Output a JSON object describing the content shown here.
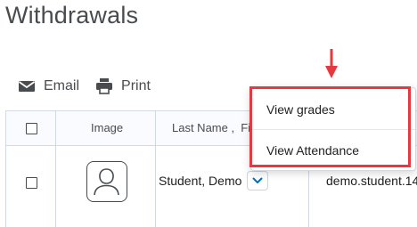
{
  "page": {
    "title": "Withdrawals"
  },
  "toolbar": {
    "email_label": "Email",
    "print_label": "Print"
  },
  "table": {
    "headers": {
      "image": "Image",
      "name": "Last Name ,  Fir"
    },
    "rows": [
      {
        "name": "Student, Demo",
        "username": "demo.student.14"
      }
    ]
  },
  "context_menu": {
    "items": [
      {
        "label": "View grades"
      },
      {
        "label": "View Attendance"
      }
    ]
  },
  "colors": {
    "highlight": "#e8383f",
    "text": "#494c4e",
    "border": "#d3d9e3",
    "link": "#006fbf"
  }
}
